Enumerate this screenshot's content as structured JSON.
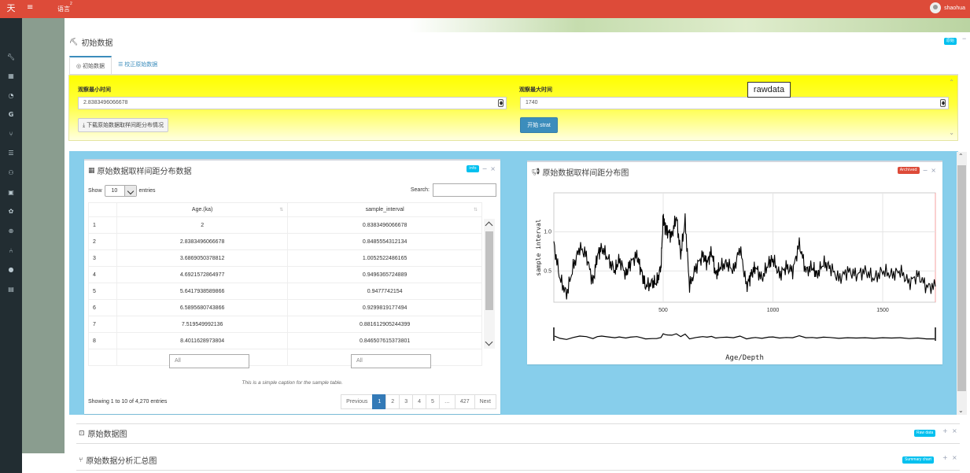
{
  "topbar": {
    "brand": "天",
    "language": "语言",
    "lang_sup": "2",
    "user": "shaohua"
  },
  "section": {
    "title": "初始数据",
    "badge": "原始",
    "badge_color": "#00c0ef"
  },
  "tabs": [
    {
      "label": "初始数据",
      "active": true
    },
    {
      "label": "校正原始数据",
      "active": false
    }
  ],
  "form": {
    "min_label": "观察最小时间",
    "min_value": "2.8383496066678",
    "max_label": "观察最大时间",
    "max_value": "1740",
    "download_label": "下载原始数据取样间距分布情况",
    "start_label": "开始 strat",
    "tooltip": "rawdata"
  },
  "table_card": {
    "title": "原始数据取样间距分布数据",
    "badge": "info",
    "show_label": "Show",
    "entries_value": "10",
    "entries_label": "entries",
    "search_label": "Search:",
    "columns": [
      "Age.(ka)",
      "sample_interval"
    ],
    "rows": [
      [
        "1",
        "2",
        "0.8383496066678"
      ],
      [
        "2",
        "2.8383496066678",
        "0.8485554312134"
      ],
      [
        "3",
        "3.6869050378812",
        "1.0052522486165"
      ],
      [
        "4",
        "4.6921572864977",
        "0.9496365724889"
      ],
      [
        "5",
        "5.6417938589866",
        "0.9477742154"
      ],
      [
        "6",
        "6.5895680743866",
        "0.9299819177494"
      ],
      [
        "7",
        "7.519549992136",
        "0.881612905244399"
      ],
      [
        "8",
        "8.4011628973804",
        "0.846507615373801"
      ]
    ],
    "filter_placeholder": "All",
    "caption": "This is a simple caption for the sample table.",
    "info": "Showing 1 to 10 of 4,270 entries",
    "pages": [
      "Previous",
      "1",
      "2",
      "3",
      "4",
      "5",
      "…",
      "427",
      "Next"
    ]
  },
  "chart_card": {
    "title": "原始数据取样间距分布图",
    "badge": "Archived",
    "badge_color": "#dd4b39"
  },
  "chart_data": {
    "type": "line",
    "title": "原始数据取样间距分布图",
    "xlabel": "Age/Depth",
    "ylabel": "sample interval",
    "x_ticks": [
      "500",
      "1000",
      "1500"
    ],
    "y_ticks": [
      "0.5",
      "1.0"
    ],
    "xlim": [
      2,
      1740
    ],
    "ylim": [
      0.1,
      1.5
    ],
    "grid": true,
    "series": [
      {
        "x": [
          2,
          30,
          60,
          90,
          120,
          150,
          180,
          200,
          220,
          250,
          280,
          300,
          330,
          350,
          380,
          400,
          420,
          450,
          470,
          490,
          500,
          510,
          520,
          540,
          560,
          580,
          600,
          620,
          650,
          680,
          700,
          720,
          740,
          760,
          790,
          820,
          850,
          880,
          900,
          920,
          950,
          980,
          1000,
          1030,
          1060,
          1090,
          1120,
          1150,
          1180,
          1200,
          1230,
          1260,
          1300,
          1340,
          1380,
          1420,
          1460,
          1500,
          1540,
          1580,
          1620,
          1660,
          1700,
          1740
        ],
        "y": [
          0.84,
          0.4,
          0.2,
          0.55,
          0.8,
          0.7,
          0.35,
          0.7,
          0.8,
          0.65,
          0.5,
          0.65,
          0.45,
          0.6,
          0.7,
          0.5,
          0.3,
          0.35,
          0.35,
          0.55,
          1.2,
          1.05,
          1.0,
          0.95,
          1.2,
          0.7,
          1.15,
          0.3,
          0.55,
          0.7,
          0.6,
          0.75,
          0.45,
          0.55,
          0.6,
          0.5,
          0.8,
          0.3,
          0.45,
          0.55,
          0.4,
          0.6,
          0.65,
          0.45,
          0.55,
          0.5,
          0.85,
          0.5,
          0.55,
          0.45,
          0.6,
          0.55,
          0.4,
          0.5,
          0.45,
          0.5,
          0.4,
          0.5,
          0.45,
          0.5,
          0.35,
          0.45,
          0.3,
          0.3
        ]
      }
    ]
  },
  "bottom": [
    {
      "title": "原始数据图",
      "badge": "Raw data",
      "badge_color": "#00c0ef"
    },
    {
      "title": "原始数据分析汇总图",
      "badge": "Summary chart",
      "badge_color": "#00c0ef"
    }
  ]
}
